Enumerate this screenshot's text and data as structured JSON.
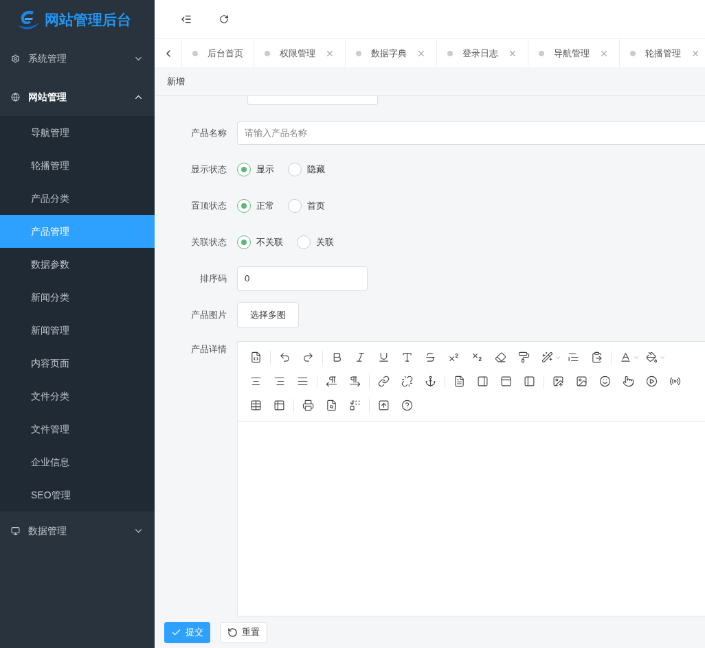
{
  "app": {
    "title": "网站管理后台"
  },
  "sidebar": [
    {
      "label": "系统管理",
      "expanded": false
    },
    {
      "label": "网站管理",
      "expanded": true,
      "children": [
        {
          "label": "导航管理",
          "selected": false
        },
        {
          "label": "轮播管理",
          "selected": false
        },
        {
          "label": "产品分类",
          "selected": false
        },
        {
          "label": "产品管理",
          "selected": true
        },
        {
          "label": "数据参数",
          "selected": false
        },
        {
          "label": "新闻分类",
          "selected": false
        },
        {
          "label": "新闻管理",
          "selected": false
        },
        {
          "label": "内容页面",
          "selected": false
        },
        {
          "label": "文件分类",
          "selected": false
        },
        {
          "label": "文件管理",
          "selected": false
        },
        {
          "label": "企业信息",
          "selected": false
        },
        {
          "label": "SEO管理",
          "selected": false
        }
      ]
    },
    {
      "label": "数据管理",
      "expanded": false
    }
  ],
  "tabs": [
    {
      "label": "后台首页",
      "closable": false
    },
    {
      "label": "权限管理",
      "closable": true
    },
    {
      "label": "数据字典",
      "closable": true
    },
    {
      "label": "登录日志",
      "closable": true
    },
    {
      "label": "导航管理",
      "closable": true
    },
    {
      "label": "轮播管理",
      "closable": true
    }
  ],
  "page_title": "新增",
  "form": [
    {
      "kind": "partial"
    },
    {
      "kind": "text",
      "label": "产品名称",
      "placeholder": "请输入产品名称"
    },
    {
      "kind": "radio",
      "label": "显示状态",
      "options": [
        {
          "label": "显示",
          "selected": true
        },
        {
          "label": "隐藏",
          "selected": false
        }
      ]
    },
    {
      "kind": "radio",
      "label": "置顶状态",
      "options": [
        {
          "label": "正常",
          "selected": true
        },
        {
          "label": "首页",
          "selected": false
        }
      ]
    },
    {
      "kind": "radio",
      "label": "关联状态",
      "options": [
        {
          "label": "不关联",
          "selected": true
        },
        {
          "label": "关联",
          "selected": false
        }
      ]
    },
    {
      "kind": "number",
      "label": "排序码",
      "value": "0"
    },
    {
      "kind": "upload",
      "label": "产品图片",
      "button": "选择多图"
    },
    {
      "kind": "editor",
      "label": "产品详情"
    }
  ],
  "buttons": [
    {
      "label": "提交",
      "kind": "primary"
    },
    {
      "label": "重置",
      "kind": "default"
    }
  ]
}
